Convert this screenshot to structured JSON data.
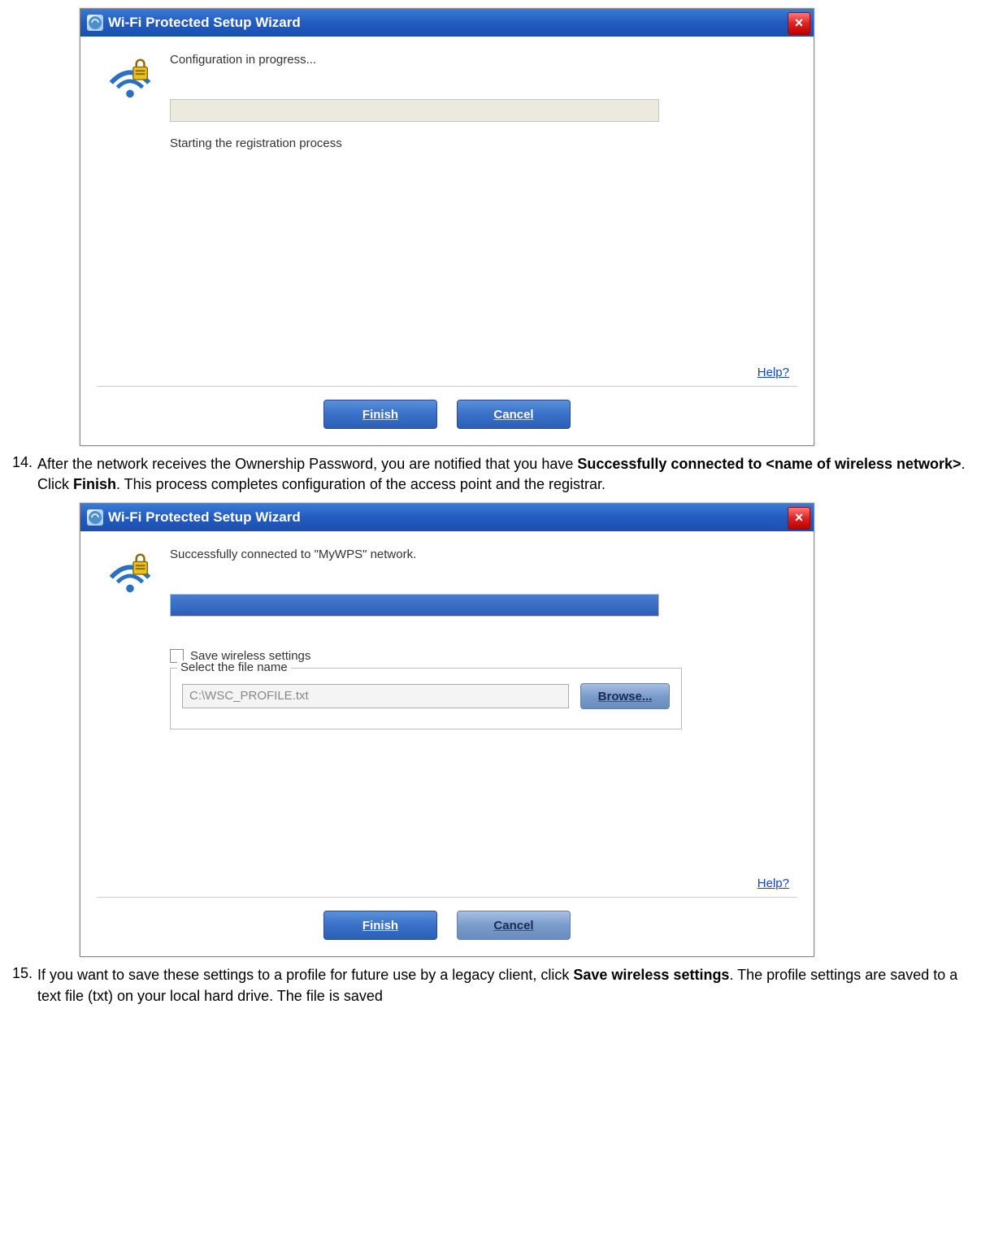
{
  "dialog1": {
    "title": "Wi-Fi Protected Setup Wizard",
    "headline": "Configuration in progress...",
    "status": "Starting the registration process",
    "helpLabel": "Help?",
    "finish": "Finish",
    "cancel": "Cancel"
  },
  "step14": {
    "num": "14.",
    "pre": "After the network receives the Ownership Password, you are notified that you have ",
    "bold1": "Successfully connected to <name of wireless network>",
    "mid": ". Click ",
    "bold2": "Finish",
    "post": ". This process completes configuration of the access point and the registrar."
  },
  "dialog2": {
    "title": "Wi-Fi Protected Setup Wizard",
    "headline": "Successfully connected to \"MyWPS\" network.",
    "saveLabel": "Save wireless settings",
    "groupLegend": "Select the file name",
    "filePath": "C:\\WSC_PROFILE.txt",
    "browse": "Browse...",
    "helpLabel": "Help?",
    "finish": "Finish",
    "cancel": "Cancel"
  },
  "step15": {
    "num": "15.",
    "pre": "If you want to save these settings to a profile for future use by a legacy client, click ",
    "bold1": "Save wireless settings",
    "post": ". The profile settings are saved to a text file (txt) on your local hard drive. The file is saved"
  }
}
